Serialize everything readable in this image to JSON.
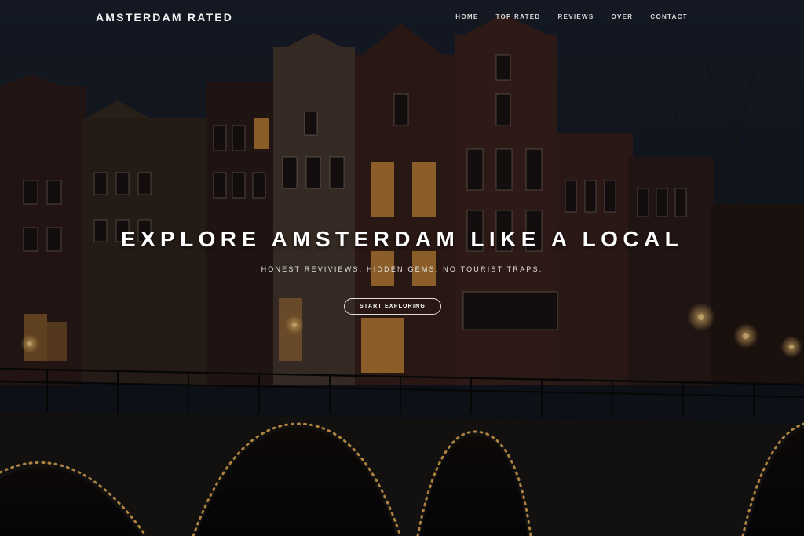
{
  "brand": {
    "name": "AMSTERDAM RATED"
  },
  "nav": {
    "items": [
      "HOME",
      "TOP RATED",
      "REVIEWS",
      "OVER",
      "CONTACT"
    ]
  },
  "hero": {
    "title": "EXPLORE AMSTERDAM LIKE A LOCAL",
    "subtitle": "HONEST REVIVIEWS. HIDDEN GEMS, NO TOURIST TRAPS.",
    "cta_label": "START EXPLORING"
  },
  "colors": {
    "sky": "#141a24",
    "brick": "#3a2520",
    "window_glow": "#e2a24a",
    "bridge_lights": "#f2b65c",
    "overlay": "#000000"
  }
}
